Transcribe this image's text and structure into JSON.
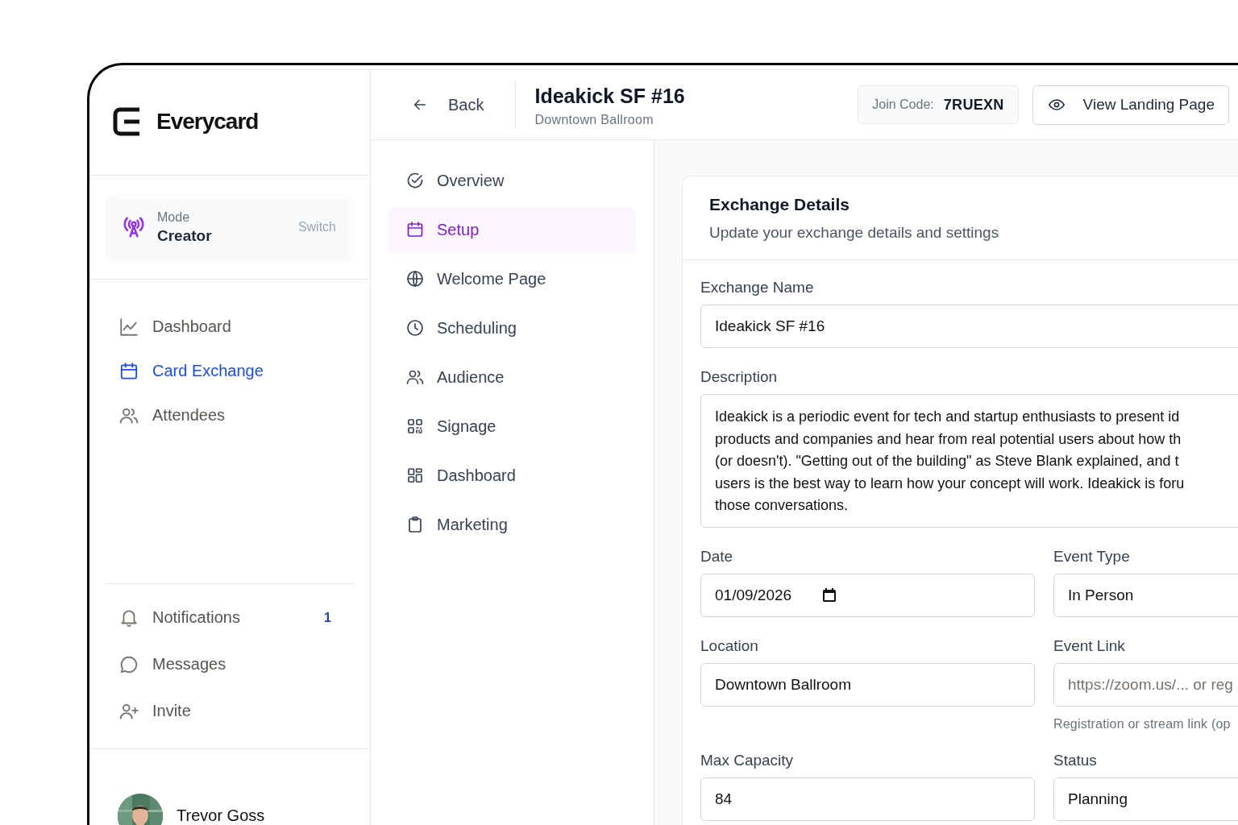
{
  "brand": {
    "name": "Everycard"
  },
  "mode_card": {
    "label": "Mode",
    "value": "Creator",
    "action": "Switch"
  },
  "sidebar": {
    "items": [
      {
        "label": "Dashboard",
        "selected": false
      },
      {
        "label": "Card Exchange",
        "selected": true
      },
      {
        "label": "Attendees",
        "selected": false
      }
    ],
    "bottom_items": [
      {
        "label": "Notifications",
        "badge": "1"
      },
      {
        "label": "Messages"
      },
      {
        "label": "Invite"
      }
    ]
  },
  "user": {
    "name": "Trevor Goss"
  },
  "header": {
    "back": "Back",
    "title": "Ideakick SF #16",
    "subtitle": "Downtown Ballroom",
    "join_code_label": "Join Code:",
    "join_code": "7RUEXN",
    "view_button": "View Landing Page"
  },
  "subnav": {
    "items": [
      {
        "label": "Overview",
        "selected": false
      },
      {
        "label": "Setup",
        "selected": true
      },
      {
        "label": "Welcome Page",
        "selected": false
      },
      {
        "label": "Scheduling",
        "selected": false
      },
      {
        "label": "Audience",
        "selected": false
      },
      {
        "label": "Signage",
        "selected": false
      },
      {
        "label": "Dashboard",
        "selected": false
      },
      {
        "label": "Marketing",
        "selected": false
      }
    ]
  },
  "card": {
    "title": "Exchange Details",
    "subtitle": "Update your exchange details and settings",
    "fields": [
      {
        "kind": "text",
        "label": "Exchange Name",
        "value": "Ideakick SF #16"
      },
      {
        "kind": "textarea",
        "label": "Description",
        "value": "Ideakick is a periodic event for tech and startup enthusiasts to present id\nproducts and companies and hear from real potential users about how th\n(or doesn't). \"Getting out of the building\" as Steve Blank explained, and t\nusers is the best way to learn how your concept will work. Ideakick is foru\nthose conversations."
      },
      {
        "kind": "date",
        "label": "Date",
        "value": "01/09/2026"
      },
      {
        "kind": "text",
        "label": "Event Type",
        "value": "In Person"
      },
      {
        "kind": "text",
        "label": "Location",
        "value": "Downtown Ballroom"
      },
      {
        "kind": "text",
        "label": "Event Link",
        "placeholder": "https://zoom.us/... or reg",
        "hint": "Registration or stream link (op"
      },
      {
        "kind": "text",
        "label": "Max Capacity",
        "value": "84"
      },
      {
        "kind": "text",
        "label": "Status",
        "value": "Planning"
      }
    ]
  }
}
